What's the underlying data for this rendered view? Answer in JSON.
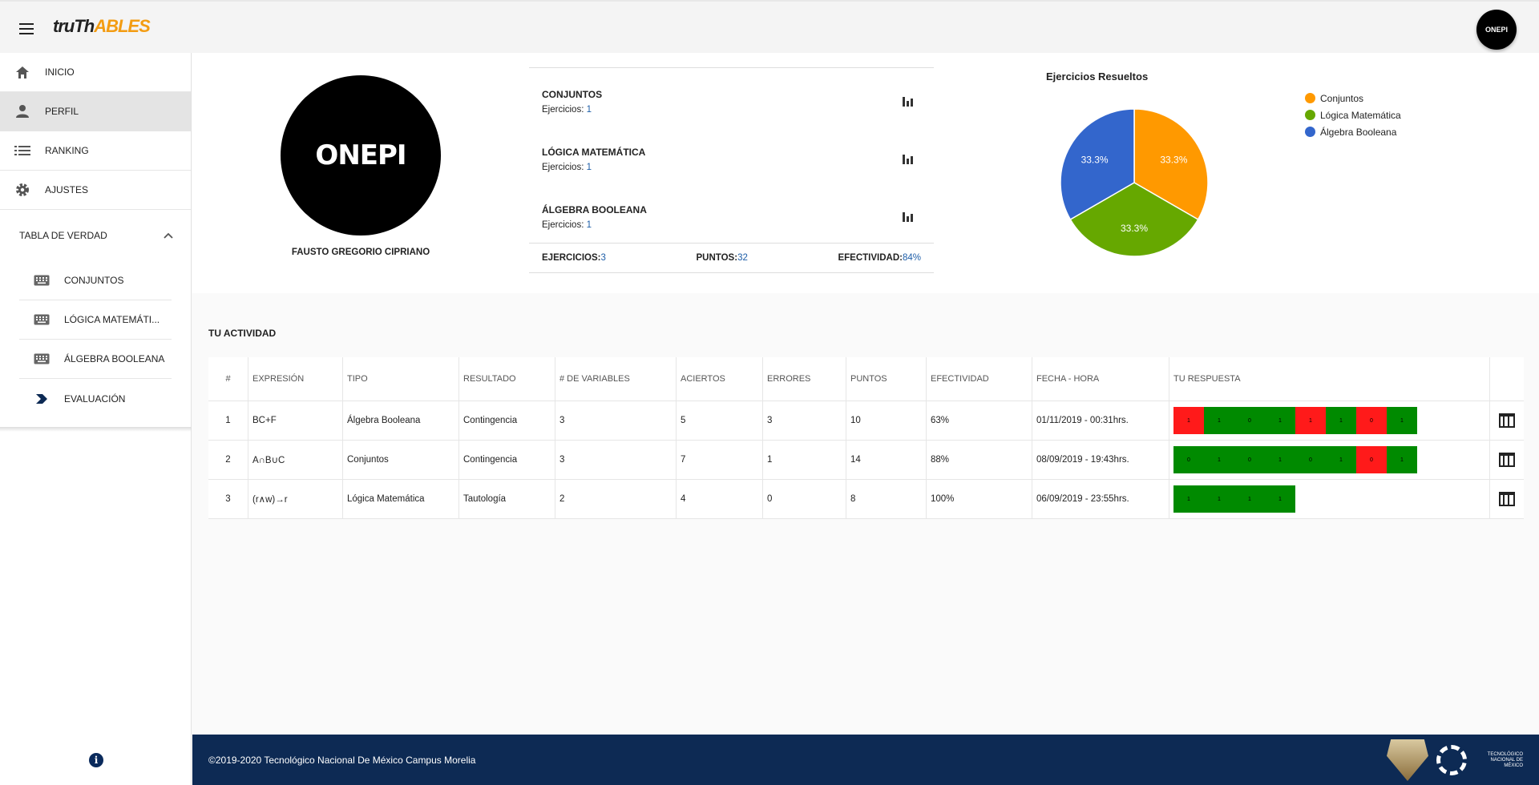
{
  "header": {
    "logo_part1": "truTh",
    "logo_part2": "ABLES",
    "avatar_text": "ONEPI"
  },
  "sidebar": {
    "items": [
      {
        "label": "INICIO",
        "icon": "home-icon"
      },
      {
        "label": "PERFIL",
        "icon": "person-icon"
      },
      {
        "label": "RANKING",
        "icon": "list-icon"
      },
      {
        "label": "AJUSTES",
        "icon": "gear-icon"
      }
    ],
    "tree_label": "TABLA DE VERDAD",
    "sub_items": [
      {
        "label": "CONJUNTOS",
        "icon": "keyboard-icon"
      },
      {
        "label": "LÓGICA MATEMÁTI...",
        "icon": "keyboard-icon"
      },
      {
        "label": "ÁLGEBRA BOOLEANA",
        "icon": "keyboard-icon"
      },
      {
        "label": "EVALUACIÓN",
        "icon": "chevron-right-icon"
      }
    ]
  },
  "profile": {
    "avatar_text": "ONEPI",
    "name": "FAUSTO GREGORIO CIPRIANO",
    "stats": [
      {
        "title": "CONJUNTOS",
        "sub_label": "Ejercicios:",
        "sub_value": "1"
      },
      {
        "title": "LÓGICA MATEMÁTICA",
        "sub_label": "Ejercicios:",
        "sub_value": "1"
      },
      {
        "title": "ÁLGEBRA BOOLEANA",
        "sub_label": "Ejercicios:",
        "sub_value": "1"
      }
    ],
    "totals": {
      "ejercicios_label": "EJERCICIOS:",
      "ejercicios": "3",
      "puntos_label": "PUNTOS:",
      "puntos": "32",
      "efectividad_label": "EFECTIVIDAD:",
      "efectividad": "84%"
    }
  },
  "chart_data": {
    "type": "pie",
    "title": "Ejercicios Resueltos",
    "categories": [
      "Conjuntos",
      "Lógica Matemática",
      "Álgebra Booleana"
    ],
    "values": [
      1,
      1,
      1
    ],
    "labels": [
      "33.3%",
      "33.3%",
      "33.3%"
    ],
    "colors": [
      "#ff9900",
      "#66a800",
      "#3366cc"
    ],
    "legend": "right"
  },
  "activity": {
    "title": "TU ACTIVIDAD",
    "headers": [
      "#",
      "EXPRESIÓN",
      "TIPO",
      "RESULTADO",
      "# DE VARIABLES",
      "ACIERTOS",
      "ERRORES",
      "PUNTOS",
      "EFECTIVIDAD",
      "FECHA - HORA",
      "TU RESPUESTA"
    ],
    "rows": [
      {
        "n": "1",
        "expr": "BC+F",
        "tipo": "Álgebra Booleana",
        "resultado": "Contingencia",
        "vars": "3",
        "aciertos": "5",
        "errores": "3",
        "puntos": "10",
        "efectividad": "63%",
        "fecha": "01/11/2019 - 00:31hrs.",
        "resp": [
          [
            "1",
            "r"
          ],
          [
            "1",
            "g"
          ],
          [
            "0",
            "g"
          ],
          [
            "1",
            "g"
          ],
          [
            "1",
            "r"
          ],
          [
            "1",
            "g"
          ],
          [
            "0",
            "r"
          ],
          [
            "1",
            "g"
          ]
        ]
      },
      {
        "n": "2",
        "expr": "A∩B∪C",
        "tipo": "Conjuntos",
        "resultado": "Contingencia",
        "vars": "3",
        "aciertos": "7",
        "errores": "1",
        "puntos": "14",
        "efectividad": "88%",
        "fecha": "08/09/2019 - 19:43hrs.",
        "resp": [
          [
            "0",
            "g"
          ],
          [
            "1",
            "g"
          ],
          [
            "0",
            "g"
          ],
          [
            "1",
            "g"
          ],
          [
            "0",
            "g"
          ],
          [
            "1",
            "g"
          ],
          [
            "0",
            "r"
          ],
          [
            "1",
            "g"
          ]
        ]
      },
      {
        "n": "3",
        "expr": "(r∧w)→r",
        "tipo": "Lógica Matemática",
        "resultado": "Tautología",
        "vars": "2",
        "aciertos": "4",
        "errores": "0",
        "puntos": "8",
        "efectividad": "100%",
        "fecha": "06/09/2019 - 23:55hrs.",
        "resp": [
          [
            "1",
            "g"
          ],
          [
            "1",
            "g"
          ],
          [
            "1",
            "g"
          ],
          [
            "1",
            "g"
          ]
        ]
      }
    ]
  },
  "footer": {
    "text": "©2019-2020 Tecnológico Nacional De México Campus Morelia",
    "logo_text": "TECNOLÓGICO NACIONAL DE MÉXICO"
  }
}
